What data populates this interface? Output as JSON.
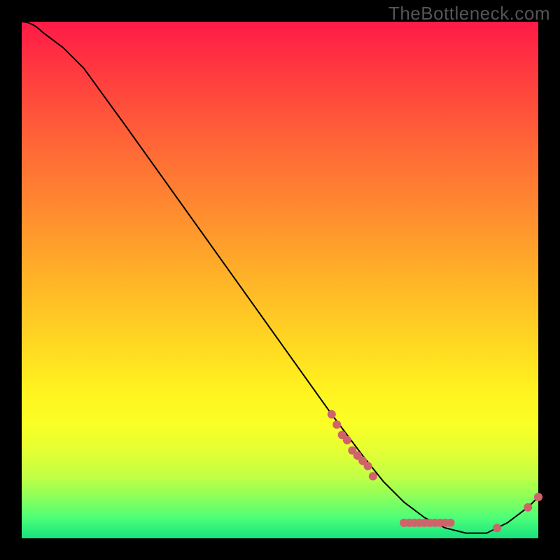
{
  "watermark": "TheBottleneck.com",
  "chart_data": {
    "type": "line",
    "title": "",
    "xlabel": "",
    "ylabel": "",
    "xlim": [
      0,
      100
    ],
    "ylim": [
      0,
      100
    ],
    "grid": false,
    "legend": false,
    "series": [
      {
        "name": "curve",
        "color": "#000000",
        "x": [
          0,
          4,
          8,
          12,
          20,
          30,
          40,
          50,
          60,
          66,
          70,
          74,
          78,
          82,
          86,
          90,
          94,
          98,
          100
        ],
        "y": [
          100,
          98,
          95,
          91,
          80,
          66,
          52,
          38,
          24,
          16,
          11,
          7,
          4,
          2,
          1,
          1,
          3,
          6,
          8
        ]
      }
    ],
    "markers": [
      {
        "name": "dots",
        "color": "#d0626c",
        "radius": 6,
        "points": [
          {
            "x": 60,
            "y": 24
          },
          {
            "x": 61,
            "y": 22
          },
          {
            "x": 62,
            "y": 20
          },
          {
            "x": 63,
            "y": 19
          },
          {
            "x": 64,
            "y": 17
          },
          {
            "x": 65,
            "y": 16
          },
          {
            "x": 66,
            "y": 15
          },
          {
            "x": 67,
            "y": 14
          },
          {
            "x": 68,
            "y": 12
          },
          {
            "x": 74,
            "y": 3
          },
          {
            "x": 75,
            "y": 3
          },
          {
            "x": 76,
            "y": 3
          },
          {
            "x": 77,
            "y": 3
          },
          {
            "x": 78,
            "y": 3
          },
          {
            "x": 79,
            "y": 3
          },
          {
            "x": 80,
            "y": 3
          },
          {
            "x": 81,
            "y": 3
          },
          {
            "x": 82,
            "y": 3
          },
          {
            "x": 83,
            "y": 3
          },
          {
            "x": 92,
            "y": 2
          },
          {
            "x": 98,
            "y": 6
          },
          {
            "x": 100,
            "y": 8
          }
        ]
      }
    ]
  }
}
